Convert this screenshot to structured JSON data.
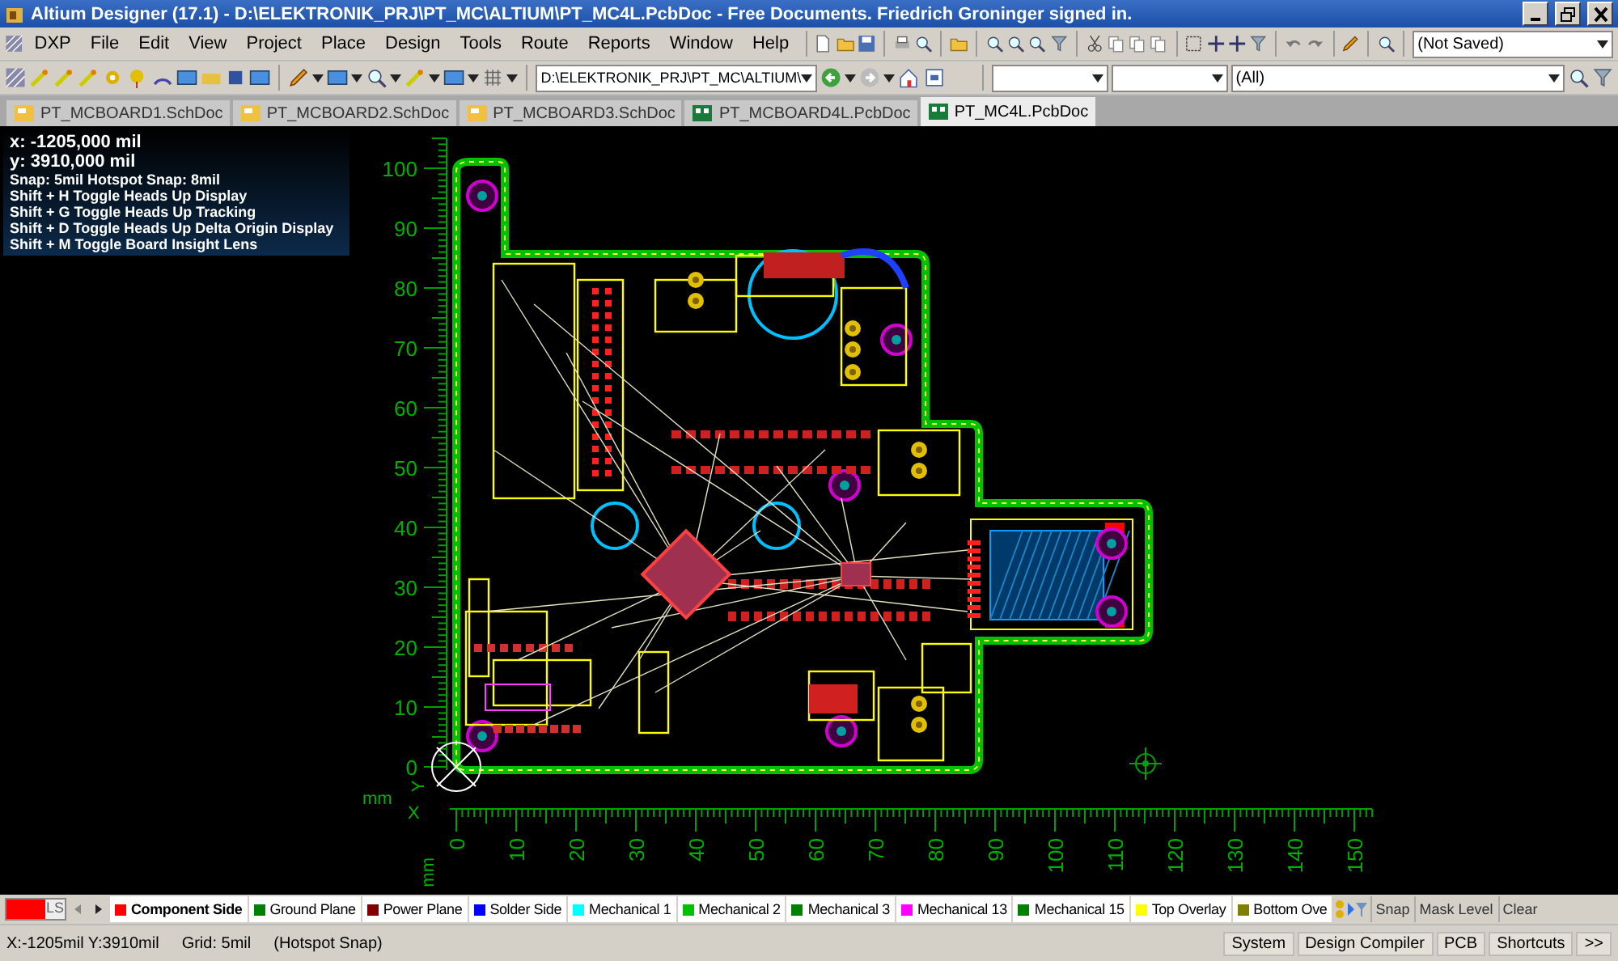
{
  "window": {
    "title": "Altium Designer (17.1) - D:\\ELEKTRONIK_PRJ\\PT_MC\\ALTIUM\\PT_MC4L.PcbDoc - Free Documents. Friedrich Groninger signed in."
  },
  "menu": [
    "DXP",
    "File",
    "Edit",
    "View",
    "Project",
    "Place",
    "Design",
    "Tools",
    "Route",
    "Reports",
    "Window",
    "Help"
  ],
  "toolbar": {
    "variant_combo": "(Not Saved)",
    "path_combo": "D:\\ELEKTRONIK_PRJ\\PT_MC\\ALTIUM\\",
    "filter_combo": "(All)"
  },
  "doc_tabs": [
    {
      "label": "PT_MCBOARD1.SchDoc",
      "kind": "sch",
      "selected": false
    },
    {
      "label": "PT_MCBOARD2.SchDoc",
      "kind": "sch",
      "selected": false
    },
    {
      "label": "PT_MCBOARD3.SchDoc",
      "kind": "sch",
      "selected": false
    },
    {
      "label": "PT_MCBOARD4L.PcbDoc",
      "kind": "pcb",
      "selected": false
    },
    {
      "label": "PT_MC4L.PcbDoc",
      "kind": "pcb",
      "selected": true
    }
  ],
  "hud": {
    "x": "x: -1205,000 mil",
    "y": "y:  3910,000 mil",
    "snap": "Snap: 5mil Hotspot Snap: 8mil",
    "shortcuts": [
      "Shift + H  Toggle Heads Up Display",
      "Shift + G  Toggle Heads Up Tracking",
      "Shift + D  Toggle Heads Up Delta Origin Display",
      "Shift + M  Toggle Board Insight Lens"
    ]
  },
  "rulers": {
    "vertical": [
      "100",
      "90",
      "80",
      "70",
      "60",
      "50",
      "40",
      "30",
      "20",
      "10",
      "0"
    ],
    "horizontal": [
      "0",
      "10",
      "20",
      "30",
      "40",
      "50",
      "60",
      "70",
      "80",
      "90",
      "100",
      "110",
      "120",
      "130",
      "140",
      "150"
    ],
    "unit_vertical": "mm",
    "unit_horizontal": "mm",
    "x_axis": "X",
    "y_axis": "Y"
  },
  "current_layer": {
    "label": "LS",
    "color": "#ff0000"
  },
  "layer_tabs": [
    {
      "label": "Component Side",
      "color": "#ff0000",
      "selected": true
    },
    {
      "label": "Ground Plane",
      "color": "#008000",
      "selected": false
    },
    {
      "label": "Power Plane",
      "color": "#800000",
      "selected": false
    },
    {
      "label": "Solder Side",
      "color": "#0000ff",
      "selected": false
    },
    {
      "label": "Mechanical 1",
      "color": "#00ffff",
      "selected": false
    },
    {
      "label": "Mechanical 2",
      "color": "#00c000",
      "selected": false
    },
    {
      "label": "Mechanical 3",
      "color": "#008000",
      "selected": false
    },
    {
      "label": "Mechanical 13",
      "color": "#ff00ff",
      "selected": false
    },
    {
      "label": "Mechanical 15",
      "color": "#008000",
      "selected": false
    },
    {
      "label": "Top Overlay",
      "color": "#ffff00",
      "selected": false
    },
    {
      "label": "Bottom Ove",
      "color": "#808000",
      "selected": false
    }
  ],
  "layer_buttons": [
    "Snap",
    "Mask Level",
    "Clear"
  ],
  "status_bar": {
    "position": "X:-1205mil Y:3910mil",
    "grid": "Grid: 5mil",
    "snap": "(Hotspot Snap)",
    "panels": [
      "System",
      "Design Compiler",
      "PCB",
      "Shortcuts",
      ">>"
    ]
  }
}
